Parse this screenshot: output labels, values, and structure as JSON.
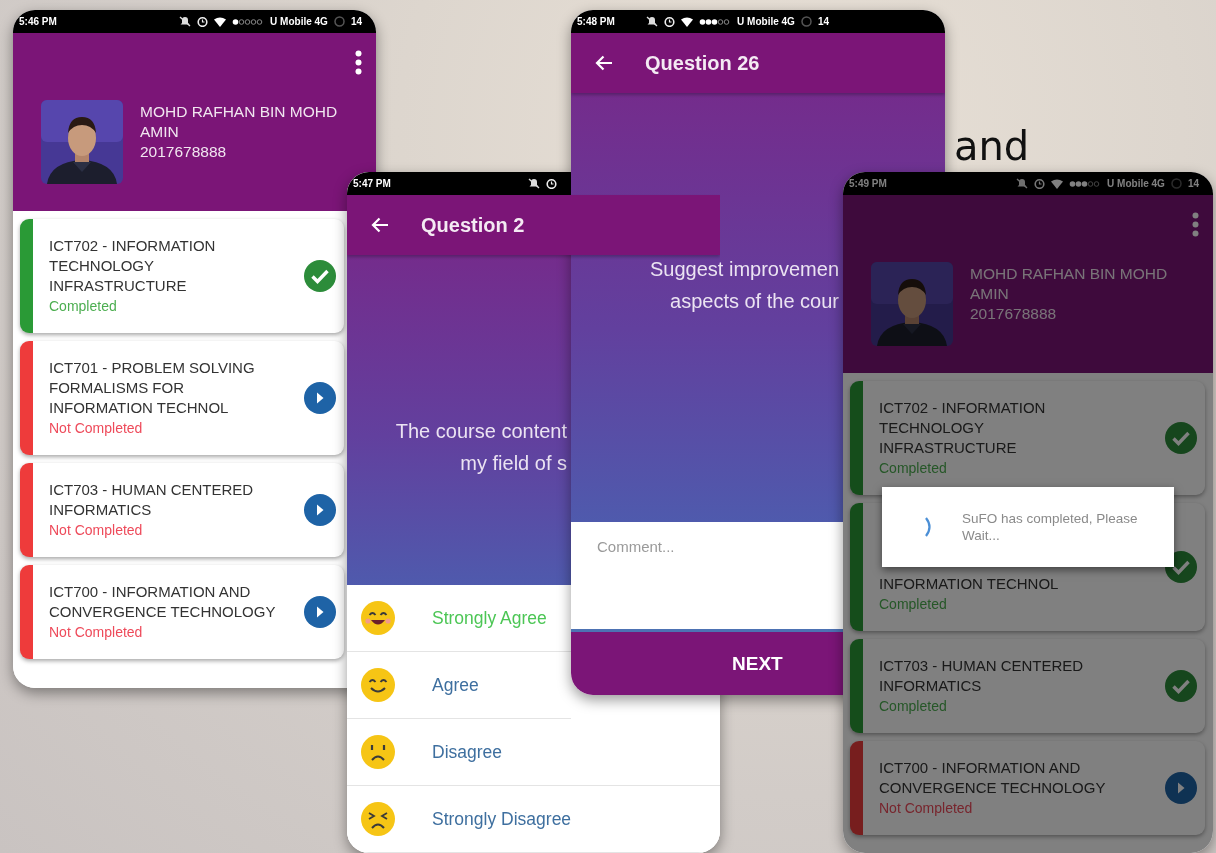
{
  "background_text": "and",
  "screens": [
    {
      "kind": "courses",
      "status": {
        "time": "5:46 PM",
        "carrier": "U Mobile 4G",
        "battery": "14"
      },
      "profile": {
        "name": "MOHD RAFHAN BIN MOHD AMIN",
        "id": "2017678888"
      },
      "courses": [
        {
          "title": "ICT702 - INFORMATION TECHNOLOGY INFRASTRUCTURE",
          "status": "Completed",
          "completed": true
        },
        {
          "title": "ICT701 - PROBLEM SOLVING FORMALISMS FOR INFORMATION TECHNOL",
          "status": "Not Completed",
          "completed": false
        },
        {
          "title": "ICT703 - HUMAN CENTERED INFORMATICS",
          "status": "Not Completed",
          "completed": false
        },
        {
          "title": "ICT700 - INFORMATION AND CONVERGENCE TECHNOLOGY",
          "status": "Not Completed",
          "completed": false
        }
      ]
    },
    {
      "kind": "rating",
      "status": {
        "time": "5:47 PM"
      },
      "title": "Question 2",
      "question_lines": [
        "The course content",
        "my field of s"
      ],
      "options": [
        {
          "label": "Strongly Agree",
          "selected": true
        },
        {
          "label": "Agree",
          "selected": false
        },
        {
          "label": "Disagree",
          "selected": false
        },
        {
          "label": "Strongly Disagree",
          "selected": false
        }
      ]
    },
    {
      "kind": "comment",
      "status": {
        "time": "5:48 PM",
        "carrier": "U Mobile 4G",
        "battery": "14"
      },
      "title": "Question 26",
      "question_lines": [
        "Suggest improvemen",
        "aspects of the cour"
      ],
      "comment": {
        "placeholder": "Comment..."
      },
      "next_button": "NEXT"
    },
    {
      "kind": "courses",
      "status": {
        "time": "5:49 PM",
        "carrier": "U Mobile 4G",
        "battery": "14"
      },
      "profile": {
        "name": "MOHD RAFHAN BIN MOHD AMIN",
        "id": "2017678888"
      },
      "courses": [
        {
          "title": "ICT702 - INFORMATION TECHNOLOGY INFRASTRUCTURE",
          "status": "Completed",
          "completed": true
        },
        {
          "title": "INFORMATION TECHNOL",
          "status": "Completed",
          "completed": true
        },
        {
          "title": "ICT703 - HUMAN CENTERED INFORMATICS",
          "status": "Completed",
          "completed": true
        },
        {
          "title": "ICT700 - INFORMATION AND CONVERGENCE TECHNOLOGY",
          "status": "Not Completed",
          "completed": false
        }
      ],
      "dialog": {
        "message": "SuFO has completed, Please Wait..."
      }
    }
  ]
}
